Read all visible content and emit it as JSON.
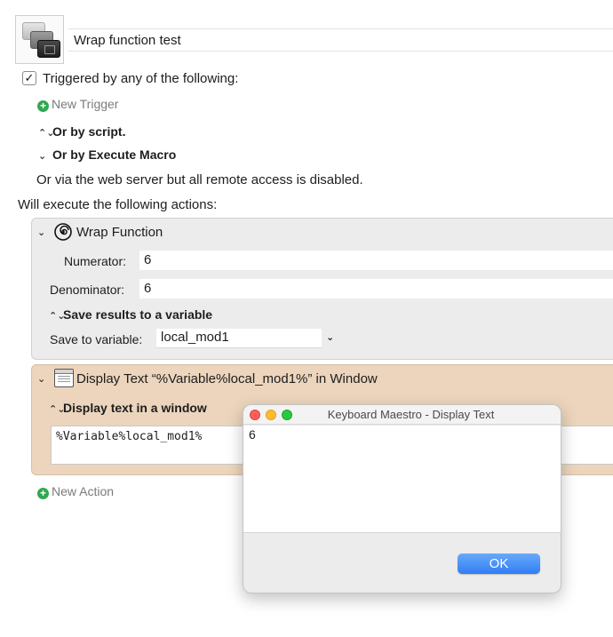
{
  "macro": {
    "title": "Wrap function test",
    "icon": "keyboard-keys-icon"
  },
  "triggers": {
    "checkbox_checked": true,
    "checkbox_mark": "✓",
    "label": "Triggered by any of the following:",
    "new_trigger_label": "New Trigger",
    "or_by_script": "Or by script.",
    "or_by_execute_macro": "Or by Execute Macro",
    "web_server_note": "Or via the web server but all remote access is disabled."
  },
  "actions_header": "Will execute the following actions:",
  "actions": [
    {
      "title": "Wrap Function",
      "icon": "spiral-icon",
      "numerator_label": "Numerator:",
      "numerator_value": "6",
      "denominator_label": "Denominator:",
      "denominator_value": "6",
      "save_results_label": "Save results to a variable",
      "save_to_variable_label": "Save to variable:",
      "save_to_variable_value": "local_mod1"
    },
    {
      "title": "Display Text “%Variable%local_mod1%” in Window",
      "icon": "window-icon",
      "display_mode_label": "Display text in a window",
      "text_value": "%Variable%local_mod1%"
    }
  ],
  "new_action_label": "New Action",
  "dialog": {
    "title": "Keyboard Maestro - Display Text",
    "content": "6",
    "ok_label": "OK"
  },
  "colors": {
    "action_gray": "#ececec",
    "action_tan": "#ecd5bc",
    "add_green": "#2fa84f",
    "ok_blue": "#2f7ef4"
  }
}
